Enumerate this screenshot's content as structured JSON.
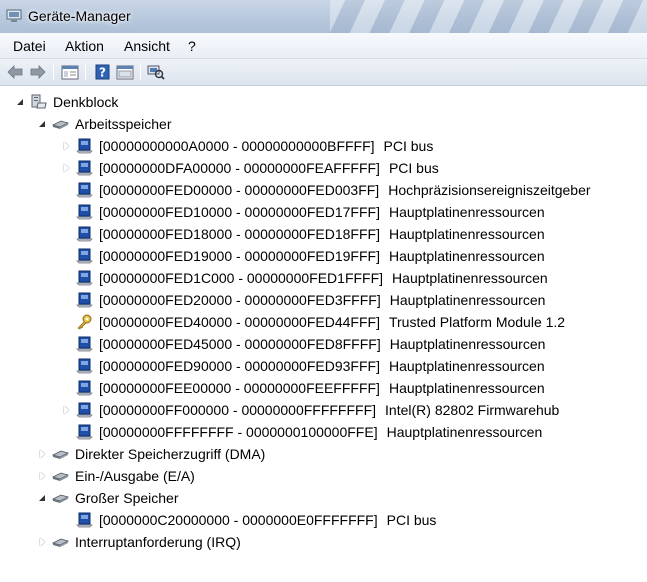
{
  "window": {
    "title": "Geräte-Manager",
    "accent": "#b7c8dd"
  },
  "menu": {
    "items": [
      "Datei",
      "Aktion",
      "Ansicht",
      "?"
    ]
  },
  "toolbar": {
    "icons": [
      "back-arrow-icon",
      "forward-arrow-icon",
      "show-hide-console-tree-icon",
      "help-icon",
      "properties-icon",
      "scan-hardware-icon"
    ]
  },
  "tree": {
    "root": {
      "label": "Denkblock",
      "icon": "computer-icon"
    },
    "categories": {
      "memory": {
        "label": "Arbeitsspeicher",
        "icon": "memory-chip-icon"
      },
      "dma": {
        "label": "Direkter Speicherzugriff (DMA)",
        "icon": "memory-chip-icon"
      },
      "io": {
        "label": "Ein-/Ausgabe (E/A)",
        "icon": "memory-chip-icon"
      },
      "large": {
        "label": "Großer Speicher",
        "icon": "memory-chip-icon"
      },
      "irq": {
        "label": "Interruptanforderung (IRQ)",
        "icon": "memory-chip-icon"
      }
    },
    "memory_items": [
      {
        "range": "[00000000000A0000 - 00000000000BFFFF]",
        "name": "PCI bus",
        "icon": "pci-device-icon"
      },
      {
        "range": "[00000000DFA00000 - 00000000FEAFFFFF]",
        "name": "PCI bus",
        "icon": "pci-device-icon"
      },
      {
        "range": "[00000000FED00000 - 00000000FED003FF]",
        "name": "Hochpräzisionsereigniszeitgeber",
        "icon": "system-device-icon"
      },
      {
        "range": "[00000000FED10000 - 00000000FED17FFF]",
        "name": "Hauptplatinenressourcen",
        "icon": "system-device-icon"
      },
      {
        "range": "[00000000FED18000 - 00000000FED18FFF]",
        "name": "Hauptplatinenressourcen",
        "icon": "system-device-icon"
      },
      {
        "range": "[00000000FED19000 - 00000000FED19FFF]",
        "name": "Hauptplatinenressourcen",
        "icon": "system-device-icon"
      },
      {
        "range": "[00000000FED1C000 - 00000000FED1FFFF]",
        "name": "Hauptplatinenressourcen",
        "icon": "system-device-icon"
      },
      {
        "range": "[00000000FED20000 - 00000000FED3FFFF]",
        "name": "Hauptplatinenressourcen",
        "icon": "system-device-icon"
      },
      {
        "range": "[00000000FED40000 - 00000000FED44FFF]",
        "name": "Trusted Platform Module 1.2",
        "icon": "security-key-icon"
      },
      {
        "range": "[00000000FED45000 - 00000000FED8FFFF]",
        "name": "Hauptplatinenressourcen",
        "icon": "system-device-icon"
      },
      {
        "range": "[00000000FED90000 - 00000000FED93FFF]",
        "name": "Hauptplatinenressourcen",
        "icon": "system-device-icon"
      },
      {
        "range": "[00000000FEE00000 - 00000000FEEFFFFF]",
        "name": "Hauptplatinenressourcen",
        "icon": "system-device-icon"
      },
      {
        "range": "[00000000FF000000 - 00000000FFFFFFFF]",
        "name": "Intel(R) 82802 Firmwarehub",
        "icon": "system-device-icon"
      },
      {
        "range": "[00000000FFFFFFFF - 0000000100000FFE]",
        "name": "Hauptplatinenressourcen",
        "icon": "system-device-icon"
      }
    ],
    "large_items": [
      {
        "range": "[0000000C20000000 - 0000000E0FFFFFFF]",
        "name": "PCI bus",
        "icon": "pci-device-icon"
      }
    ]
  }
}
